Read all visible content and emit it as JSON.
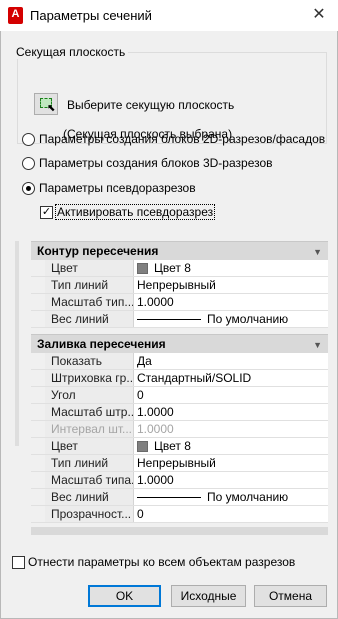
{
  "window": {
    "title": "Параметры сечений",
    "app_icon_letter": "A",
    "close_icon": "close-icon"
  },
  "cutting_plane": {
    "legend": "Секущая плоскость",
    "pick_label": "Выберите секущую плоскость",
    "status": "(Секущая плоскость выбрана)",
    "pick_icon": "select-plane-icon"
  },
  "options": {
    "radio_2d": "Параметры создания блоков 2D-разрезов/фасадов",
    "radio_3d": "Параметры создания блоков 3D-разрезов",
    "radio_live": "Параметры псевдоразрезов",
    "selected": "radio_live",
    "activate_live_label": "Активировать псевдоразрез",
    "activate_live_checked": true
  },
  "sections": {
    "intersection_boundary": {
      "title": "Контур пересечения",
      "rows": [
        {
          "name": "Цвет",
          "value": "Цвет 8"
        },
        {
          "name": "Тип линий",
          "value": "Непрерывный"
        },
        {
          "name": "Масштаб тип...",
          "value": "1.0000"
        },
        {
          "name": "Вес линий",
          "value": "По умолчанию"
        }
      ]
    },
    "intersection_fill": {
      "title": "Заливка пересечения",
      "rows": [
        {
          "name": "Показать",
          "value": "Да"
        },
        {
          "name": "Штриховка гр...",
          "value": "Стандартный/SOLID"
        },
        {
          "name": "Угол",
          "value": "0"
        },
        {
          "name": "Масштаб штр...",
          "value": "1.0000"
        },
        {
          "name": "Интервал шт...",
          "value": "1.0000"
        },
        {
          "name": "Цвет",
          "value": "Цвет 8"
        },
        {
          "name": "Тип линий",
          "value": "Непрерывный"
        },
        {
          "name": "Масштаб типа...",
          "value": "1.0000"
        },
        {
          "name": "Вес линий",
          "value": "По умолчанию"
        },
        {
          "name": "Прозрачност...",
          "value": "0"
        }
      ]
    }
  },
  "swatch_color": "#808080",
  "apply_all_label": "Отнести параметры ко всем объектам разрезов",
  "apply_all_checked": false,
  "buttons": {
    "ok": "OK",
    "reset": "Исходные",
    "cancel": "Отмена"
  }
}
